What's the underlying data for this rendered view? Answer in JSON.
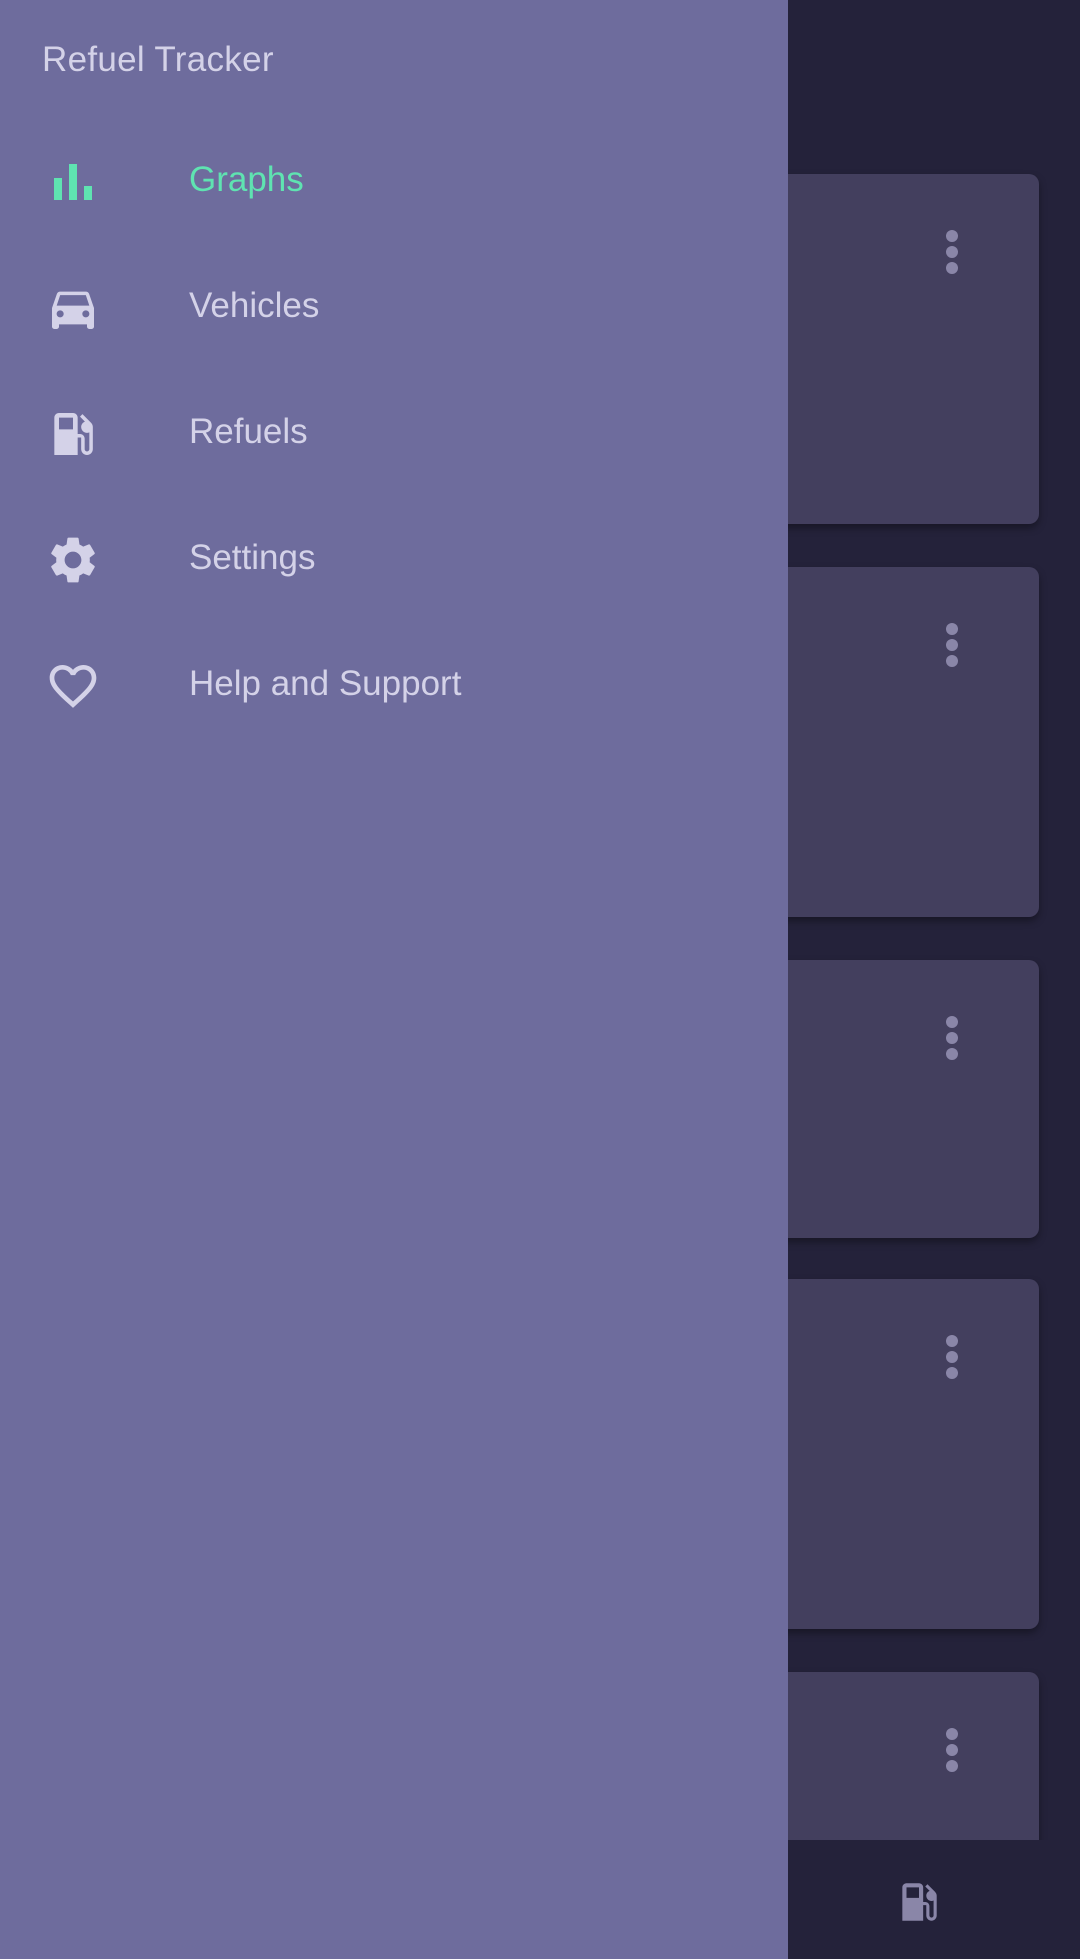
{
  "app": {
    "title": "Refuel Tracker"
  },
  "drawer": {
    "items": [
      {
        "label": "Graphs",
        "icon": "bar-chart-icon",
        "active": true
      },
      {
        "label": "Vehicles",
        "icon": "car-icon",
        "active": false
      },
      {
        "label": "Refuels",
        "icon": "fuel-pump-icon",
        "active": false
      },
      {
        "label": "Settings",
        "icon": "gear-icon",
        "active": false
      },
      {
        "label": "Help and Support",
        "icon": "heart-icon",
        "active": false
      }
    ]
  },
  "bottom_bar": {
    "icon": "fuel-pump-icon"
  },
  "colors": {
    "drawer_bg": "#6e6c9d",
    "accent": "#5fe3b1",
    "text": "#d4d2e8",
    "background": "#24223a",
    "card": "#433f5e"
  }
}
